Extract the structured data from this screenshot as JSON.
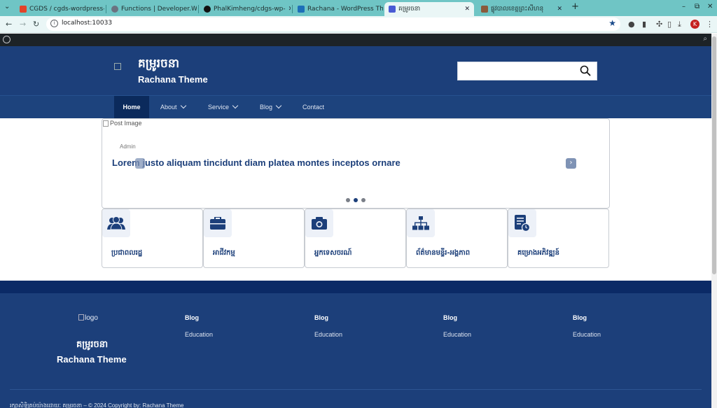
{
  "browser": {
    "tabs": [
      {
        "title": "CGDS / cgds-wordpress-",
        "favicon_color": "#e24329"
      },
      {
        "title": "Functions | Developer.W",
        "favicon_color": "#6b7280"
      },
      {
        "title": "PhalKimheng/cdgs-wp-",
        "favicon_color": "#111111"
      },
      {
        "title": "Rachana - WordPress Th",
        "favicon_color": "#1d6fb8"
      },
      {
        "title": "គម្រូរចនា",
        "favicon_color": "#4a5bd4"
      },
      {
        "title": "ផ្លូវបាលខេត្តព្រះសីហនុ",
        "favicon_color": "#8a5a3b"
      }
    ],
    "url": "localhost:10033",
    "profile_initial": "K"
  },
  "header": {
    "site_title_kh": "គម្រូរចនា",
    "site_name": "Rachana Theme",
    "search_placeholder": ""
  },
  "nav": {
    "items": [
      {
        "label": "Home",
        "active": true,
        "has_submenu": false
      },
      {
        "label": "About",
        "active": false,
        "has_submenu": true
      },
      {
        "label": "Service",
        "active": false,
        "has_submenu": true
      },
      {
        "label": "Blog",
        "active": false,
        "has_submenu": true
      },
      {
        "label": "Contact",
        "active": false,
        "has_submenu": false
      }
    ]
  },
  "slider": {
    "image_alt": "Post Image",
    "author": "Admin",
    "title": "Lorem justo aliquam tincidunt diam platea montes inceptos ornare",
    "dots": 3,
    "active_dot": 1
  },
  "services": [
    {
      "label": "ប្រជាពលរដ្ឋ",
      "icon": "users-icon"
    },
    {
      "label": "អាជីវកម្ម",
      "icon": "briefcase-icon"
    },
    {
      "label": "អ្នកទេសចរណ៍",
      "icon": "camera-icon"
    },
    {
      "label": "ព័ត៌មានមន្ទីរ-អង្គភាព",
      "icon": "sitemap-icon"
    },
    {
      "label": "គម្រោងអភិវឌ្ឍន៍",
      "icon": "schedule-list-icon"
    }
  ],
  "footer": {
    "logo_alt": "logo",
    "site_title_kh": "គម្រូរចនា",
    "site_name": "Rachana Theme",
    "columns": [
      {
        "title": "Blog",
        "link": "Education"
      },
      {
        "title": "Blog",
        "link": "Education"
      },
      {
        "title": "Blog",
        "link": "Education"
      },
      {
        "title": "Blog",
        "link": "Education"
      }
    ],
    "copyright": "រក្សាសិទ្ធិគ្រប់យ៉ាងដោយៈ គម្រូរចនា – © 2024 Copyright by: Rachana Theme"
  },
  "colors": {
    "primary": "#1c3f7a",
    "nav_active": "#0b2a5c",
    "tabstrip": "#6fc5c5"
  }
}
